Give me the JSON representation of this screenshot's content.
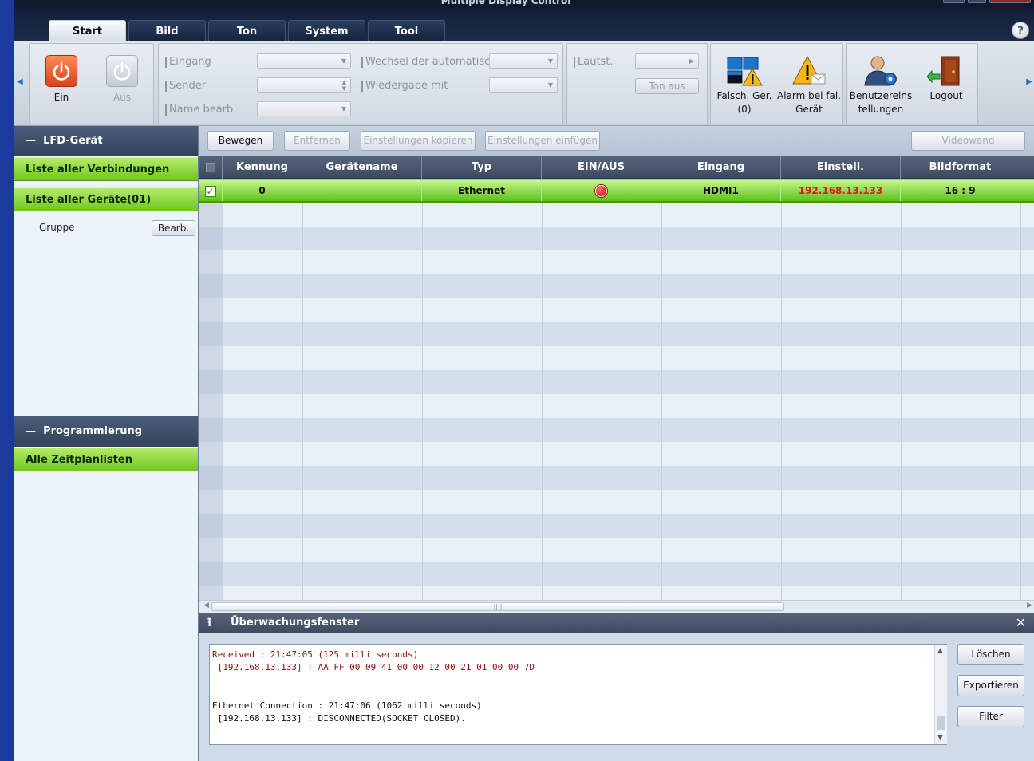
{
  "window": {
    "title": "Multiple Display Control",
    "help_label": "?"
  },
  "tabs": [
    {
      "label": "Start",
      "active": true
    },
    {
      "label": "Bild",
      "active": false
    },
    {
      "label": "Ton",
      "active": false
    },
    {
      "label": "System",
      "active": false
    },
    {
      "label": "Tool",
      "active": false
    }
  ],
  "ribbon": {
    "power_on_label": "Ein",
    "power_off_label": "Aus",
    "eingang_label": "Eingang",
    "sender_label": "Sender",
    "name_label": "Name bearb.",
    "wechsel_label": "Wechsel der automatischen",
    "wiedergabe_label": "Wiedergabe mit",
    "lautst_label": "Lautst.",
    "ton_aus_label": "Ton aus",
    "falsch_label_1": "Falsch. Ger.",
    "falsch_label_2": "(0)",
    "alarm_label_1": "Alarm bei fal.",
    "alarm_label_2": "Gerät",
    "user_label_1": "Benutzereins",
    "user_label_2": "tellungen",
    "logout_label": "Logout"
  },
  "sidebar": {
    "lfd_header": "LFD-Gerät",
    "all_connections": "Liste aller Verbindungen",
    "all_devices": "Liste aller Geräte(01)",
    "group_label": "Gruppe",
    "edit_label": "Bearb.",
    "prog_header": "Programmierung",
    "all_schedules": "Alle Zeitplanlisten",
    "collapse_symbol": "—"
  },
  "toolbar": {
    "move": "Bewegen",
    "remove": "Entfernen",
    "copy": "Einstellungen kopieren",
    "paste": "Einstellungen einfügen",
    "videowall": "Videowand"
  },
  "table": {
    "columns": [
      "Kennung",
      "Gerätename",
      "Typ",
      "EIN/AUS",
      "Eingang",
      "Einstell.",
      "Bildformat"
    ],
    "rows": [
      {
        "checked": true,
        "kennung": "0",
        "geraetename": "--",
        "typ": "Ethernet",
        "power": "off",
        "eingang": "HDMI1",
        "einstell": "192.168.13.133",
        "bildformat": "16 : 9"
      }
    ]
  },
  "monitor": {
    "title": "Überwachungsfenster",
    "log": [
      {
        "text": "Received : 21:47:05 (125 milli seconds)",
        "color": "red"
      },
      {
        "text": " [192.168.13.133] : AA FF 00 09 41 00 00 12 00 21 01 00 00 7D",
        "color": "red"
      },
      {
        "text": "",
        "color": "black"
      },
      {
        "text": "",
        "color": "black"
      },
      {
        "text": "Ethernet Connection : 21:47:06 (1062 milli seconds)",
        "color": "black"
      },
      {
        "text": " [192.168.13.133] : DISCONNECTED(SOCKET CLOSED).",
        "color": "black"
      }
    ],
    "clear": "Löschen",
    "export": "Exportieren",
    "filter": "Filter"
  },
  "colors": {
    "accent_green": "#6fc71f",
    "ip_red": "#e0141e",
    "header_dark": "#3d4a5e"
  }
}
